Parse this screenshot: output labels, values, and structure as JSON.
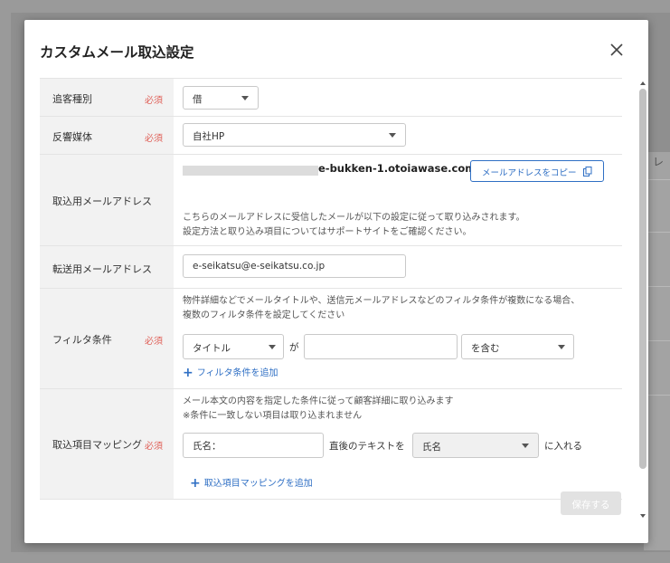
{
  "background": {
    "partial_text": "レ"
  },
  "modal": {
    "title": "カスタムメール取込設定",
    "close_icon": "close-icon"
  },
  "colors": {
    "required": "#e0625a",
    "link": "#2f6fc4",
    "label_bg": "#f2f2f2"
  },
  "rows": {
    "customer_type": {
      "label": "追客種別",
      "required": "必須",
      "value": "借"
    },
    "media": {
      "label": "反響媒体",
      "required": "必須",
      "value": "自社HP"
    },
    "import_email": {
      "label": "取込用メールアドレス",
      "email_domain": "e-bukken-1.otoiawase.com",
      "copy_button": "メールアドレスをコピー",
      "copy_icon": "copy-icon",
      "note_line1": "こちらのメールアドレスに受信したメールが以下の設定に従って取り込みされます。",
      "note_line2": "設定方法と取り込み項目についてはサポートサイトをご確認ください。"
    },
    "forward_email": {
      "label": "転送用メールアドレス",
      "value": "e-seikatsu@e-seikatsu.co.jp"
    },
    "filter": {
      "label": "フィルタ条件",
      "required": "必須",
      "note_line1": "物件詳細などでメールタイトルや、送信元メールアドレスなどのフィルタ条件が複数になる場合、",
      "note_line2": "複数のフィルタ条件を設定してください",
      "field": "タイトル",
      "particle": "が",
      "value": "",
      "operator": "を含む",
      "add_link": "フィルタ条件を追加"
    },
    "mapping": {
      "label": "取込項目マッピング",
      "required": "必須",
      "note_line1": "メール本文の内容を指定した条件に従って顧客詳細に取り込みます",
      "note_line2": "※条件に一致しない項目は取り込まれません",
      "source_value": "氏名：",
      "middle_text": "直後のテキストを",
      "target": "氏名",
      "suffix_text": "に入れる",
      "add_link": "取込項目マッピングを追加"
    }
  },
  "footer": {
    "save": "保存する"
  }
}
